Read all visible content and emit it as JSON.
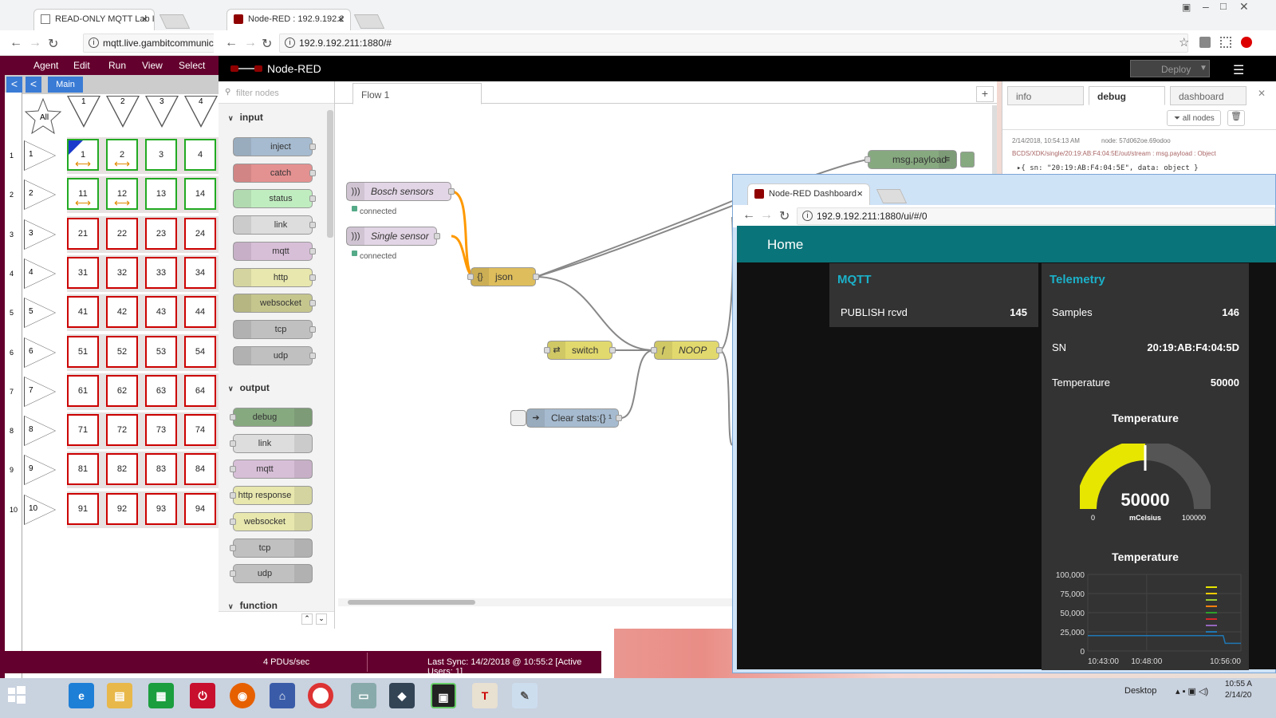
{
  "left_window": {
    "tab_title": "READ-ONLY MQTT Lab I",
    "url": "mqtt.live.gambitcommunica",
    "menu": [
      "Agent",
      "Edit",
      "Run",
      "View",
      "Select"
    ],
    "main_tab": "Main",
    "nav_back": "<",
    "all_label": "All",
    "column_numbers": [
      "1",
      "2",
      "3",
      "4"
    ],
    "row_numbers": [
      "1",
      "2",
      "3",
      "4",
      "5",
      "6",
      "7",
      "8",
      "9",
      "10"
    ],
    "grid": [
      [
        {
          "v": "1",
          "g": true,
          "a": true
        },
        {
          "v": "2",
          "g": true,
          "a": true
        },
        {
          "v": "3",
          "g": true
        },
        {
          "v": "4",
          "g": true
        }
      ],
      [
        {
          "v": "11",
          "g": true,
          "a": true
        },
        {
          "v": "12",
          "g": true,
          "a": true
        },
        {
          "v": "13",
          "g": true
        },
        {
          "v": "14",
          "g": true
        }
      ],
      [
        {
          "v": "21"
        },
        {
          "v": "22"
        },
        {
          "v": "23"
        },
        {
          "v": "24"
        }
      ],
      [
        {
          "v": "31"
        },
        {
          "v": "32"
        },
        {
          "v": "33"
        },
        {
          "v": "34"
        }
      ],
      [
        {
          "v": "41"
        },
        {
          "v": "42"
        },
        {
          "v": "43"
        },
        {
          "v": "44"
        }
      ],
      [
        {
          "v": "51"
        },
        {
          "v": "52"
        },
        {
          "v": "53"
        },
        {
          "v": "54"
        }
      ],
      [
        {
          "v": "61"
        },
        {
          "v": "62"
        },
        {
          "v": "63"
        },
        {
          "v": "64"
        }
      ],
      [
        {
          "v": "71"
        },
        {
          "v": "72"
        },
        {
          "v": "73"
        },
        {
          "v": "74"
        }
      ],
      [
        {
          "v": "81"
        },
        {
          "v": "82"
        },
        {
          "v": "83"
        },
        {
          "v": "84"
        }
      ],
      [
        {
          "v": "91"
        },
        {
          "v": "92"
        },
        {
          "v": "93"
        },
        {
          "v": "94"
        }
      ]
    ],
    "status_rate": "4 PDUs/sec",
    "status_sync": "Last Sync: 14/2/2018 @ 10:55:2 [Active Users: 1]"
  },
  "nodered_window": {
    "tab_title": "Node-RED : 192.9.192.2",
    "url": "192.9.192.211:1880/#",
    "app_title": "Node-RED",
    "deploy_label": "Deploy",
    "filter_placeholder": "filter nodes",
    "palette": {
      "input_label": "input",
      "input_nodes": [
        "inject",
        "catch",
        "status",
        "link",
        "mqtt",
        "http",
        "websocket",
        "tcp",
        "udp"
      ],
      "output_label": "output",
      "output_nodes": [
        "debug",
        "link",
        "mqtt",
        "http response",
        "websocket",
        "tcp",
        "udp"
      ],
      "function_label": "function"
    },
    "flow_tab": "Flow 1",
    "flow_nodes": {
      "bosch": "Bosch sensors",
      "single": "Single sensor",
      "connected": "connected",
      "json": "json",
      "switch": "switch",
      "noop": "NOOP",
      "clear": "Clear stats:{} ¹",
      "msg_payload": "msg.payload"
    },
    "sidebar": {
      "tabs": [
        "info",
        "debug",
        "dashboard"
      ],
      "filter_button": "all nodes",
      "debug_time": "2/14/2018, 10:54:13 AM",
      "debug_node": "node: 57d062oe.69odoo",
      "debug_topic": "BCDS/XDK/single/20:19:AB:F4:04:5E/out/stream : msg.payload : Object",
      "debug_value": "▸{ sn: \"20:19:AB:F4:04:5E\", data: object }"
    }
  },
  "dashboard_window": {
    "tab_title": "Node-RED Dashboard",
    "url": "192.9.192.211:1880/ui/#/0",
    "home": "Home",
    "mqtt": {
      "title": "MQTT",
      "label": "PUBLISH rcvd",
      "value": "145"
    },
    "telemetry": {
      "title": "Telemetry",
      "rows": [
        {
          "label": "Samples",
          "value": "146"
        },
        {
          "label": "SN",
          "value": "20:19:AB:F4:04:5D"
        },
        {
          "label": "Temperature",
          "value": "50000"
        }
      ],
      "gauge_title": "Temperature",
      "gauge_value": "50000",
      "gauge_fraction": 0.5,
      "gauge_unit": "mCelsius",
      "gauge_min": "0",
      "gauge_max": "100000",
      "chart_title": "Temperature"
    },
    "colors": {
      "toolbar": "#097479",
      "accent": "#1bb1c9",
      "gauge_fill": "#e6e600"
    }
  },
  "chart_data": {
    "type": "line",
    "title": "Temperature",
    "y_ticks": [
      "100,000",
      "75,000",
      "50,000",
      "25,000",
      "0"
    ],
    "x_ticks": [
      "10:43:00",
      "10:48:00",
      "10:56:00"
    ],
    "ylim": [
      0,
      100000
    ],
    "series": [
      {
        "x": [
          "10:43:00",
          "10:54:30",
          "10:54:40",
          "10:56:00"
        ],
        "values": [
          20000,
          20000,
          10000,
          10000
        ]
      }
    ]
  },
  "taskbar": {
    "desktop_label": "Desktop",
    "time": "10:55 A",
    "date": "2/14/20"
  }
}
